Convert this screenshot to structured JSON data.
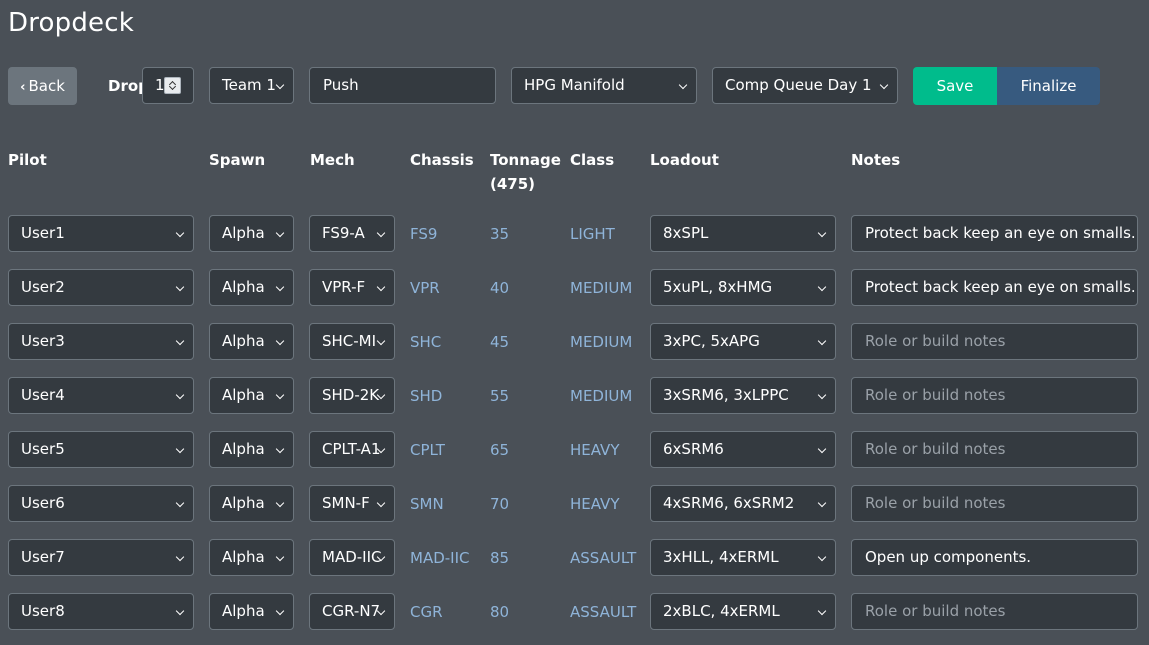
{
  "app": {
    "title": "Dropdeck"
  },
  "toolbar": {
    "back_label": "Back",
    "drop_label": "Drop",
    "drop_value": "1",
    "team_value": "Team 1",
    "name_value": "Push",
    "map_value": "HPG Manifold",
    "queue_value": "Comp Queue Day 1",
    "save_label": "Save",
    "finalize_label": "Finalize"
  },
  "table": {
    "headers": {
      "pilot": "Pilot",
      "spawn": "Spawn",
      "mech": "Mech",
      "chassis": "Chassis",
      "tonnage": "Tonnage",
      "tonnage_total": "(475)",
      "class": "Class",
      "loadout": "Loadout",
      "notes": "Notes"
    },
    "notes_placeholder": "Role or build notes",
    "rows": [
      {
        "pilot": "User1",
        "spawn": "Alpha",
        "mech": "FS9-A",
        "chassis": "FS9",
        "tonnage": "35",
        "class": "LIGHT",
        "loadout": "8xSPL",
        "notes": "Protect back keep an eye on smalls."
      },
      {
        "pilot": "User2",
        "spawn": "Alpha",
        "mech": "VPR-F",
        "chassis": "VPR",
        "tonnage": "40",
        "class": "MEDIUM",
        "loadout": "5xuPL, 8xHMG",
        "notes": "Protect back keep an eye on smalls."
      },
      {
        "pilot": "User3",
        "spawn": "Alpha",
        "mech": "SHC-MI",
        "chassis": "SHC",
        "tonnage": "45",
        "class": "MEDIUM",
        "loadout": "3xPC, 5xAPG",
        "notes": ""
      },
      {
        "pilot": "User4",
        "spawn": "Alpha",
        "mech": "SHD-2K",
        "chassis": "SHD",
        "tonnage": "55",
        "class": "MEDIUM",
        "loadout": "3xSRM6, 3xLPPC",
        "notes": ""
      },
      {
        "pilot": "User5",
        "spawn": "Alpha",
        "mech": "CPLT-A1",
        "chassis": "CPLT",
        "tonnage": "65",
        "class": "HEAVY",
        "loadout": "6xSRM6",
        "notes": ""
      },
      {
        "pilot": "User6",
        "spawn": "Alpha",
        "mech": "SMN-F",
        "chassis": "SMN",
        "tonnage": "70",
        "class": "HEAVY",
        "loadout": "4xSRM6, 6xSRM2",
        "notes": ""
      },
      {
        "pilot": "User7",
        "spawn": "Alpha",
        "mech": "MAD-IIC",
        "chassis": "MAD-IIC",
        "tonnage": "85",
        "class": "ASSAULT",
        "loadout": "3xHLL, 4xERML",
        "notes": "Open up components."
      },
      {
        "pilot": "User8",
        "spawn": "Alpha",
        "mech": "CGR-N7",
        "chassis": "CGR",
        "tonnage": "80",
        "class": "ASSAULT",
        "loadout": "2xBLC, 4xERML",
        "notes": ""
      }
    ]
  },
  "colors": {
    "background": "#4a5057",
    "input": "#343a40",
    "save": "#00bc8c",
    "finalize": "#375a7f",
    "info_text": "#8fb4d9"
  }
}
